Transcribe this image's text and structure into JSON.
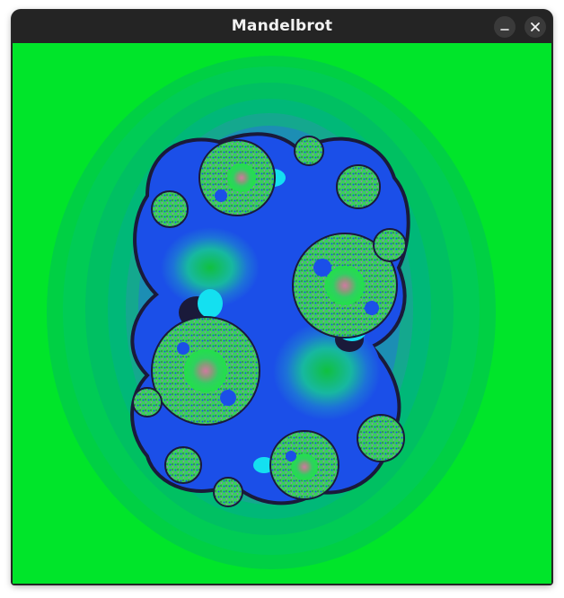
{
  "window": {
    "title": "Mandelbrot"
  },
  "controls": {
    "minimize_icon": "minimize-icon",
    "close_icon": "close-icon"
  },
  "colors": {
    "titlebar": "#242424",
    "title_text": "#f2f2f2",
    "button_bg": "#3a3a3a",
    "background_green": "#00e52a",
    "band_1": "#00cc55",
    "band_2": "#00b878",
    "band_3": "#16a29a",
    "band_4": "#1c7ec9",
    "fractal_blue": "#1b4fe8",
    "fractal_dark": "#1a1a3a",
    "fractal_cyan": "#14e0f0"
  }
}
